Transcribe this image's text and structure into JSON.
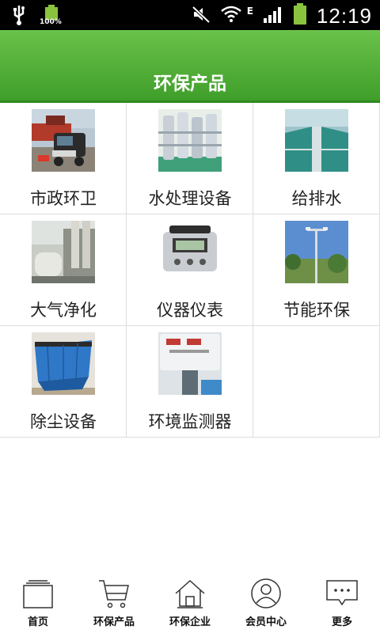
{
  "status_bar": {
    "battery_label": "100%",
    "network_label": "E",
    "time": "12:19",
    "icons": [
      "usb-icon",
      "battery-full-icon",
      "mute-icon",
      "wifi-icon",
      "signal-icon",
      "battery-icon"
    ]
  },
  "header": {
    "title": "环保产品"
  },
  "categories": [
    {
      "label": "市政环卫",
      "icon": "street-sweeper-image"
    },
    {
      "label": "水处理设备",
      "icon": "water-treatment-image"
    },
    {
      "label": "给排水",
      "icon": "water-supply-image"
    },
    {
      "label": "大气净化",
      "icon": "air-purification-image"
    },
    {
      "label": "仪器仪表",
      "icon": "instrument-image"
    },
    {
      "label": "节能环保",
      "icon": "energy-saving-image"
    },
    {
      "label": "除尘设备",
      "icon": "dust-removal-image"
    },
    {
      "label": "环境监测器",
      "icon": "environment-monitor-image"
    }
  ],
  "bottom_nav": [
    {
      "label": "首页",
      "icon": "home-page-icon"
    },
    {
      "label": "环保产品",
      "icon": "cart-icon"
    },
    {
      "label": "环保企业",
      "icon": "house-icon"
    },
    {
      "label": "会员中心",
      "icon": "user-icon"
    },
    {
      "label": "更多",
      "icon": "more-icon"
    }
  ],
  "colors": {
    "header_green": "#4aa832",
    "status_bg": "#000000",
    "battery_green": "#8ac43f"
  }
}
